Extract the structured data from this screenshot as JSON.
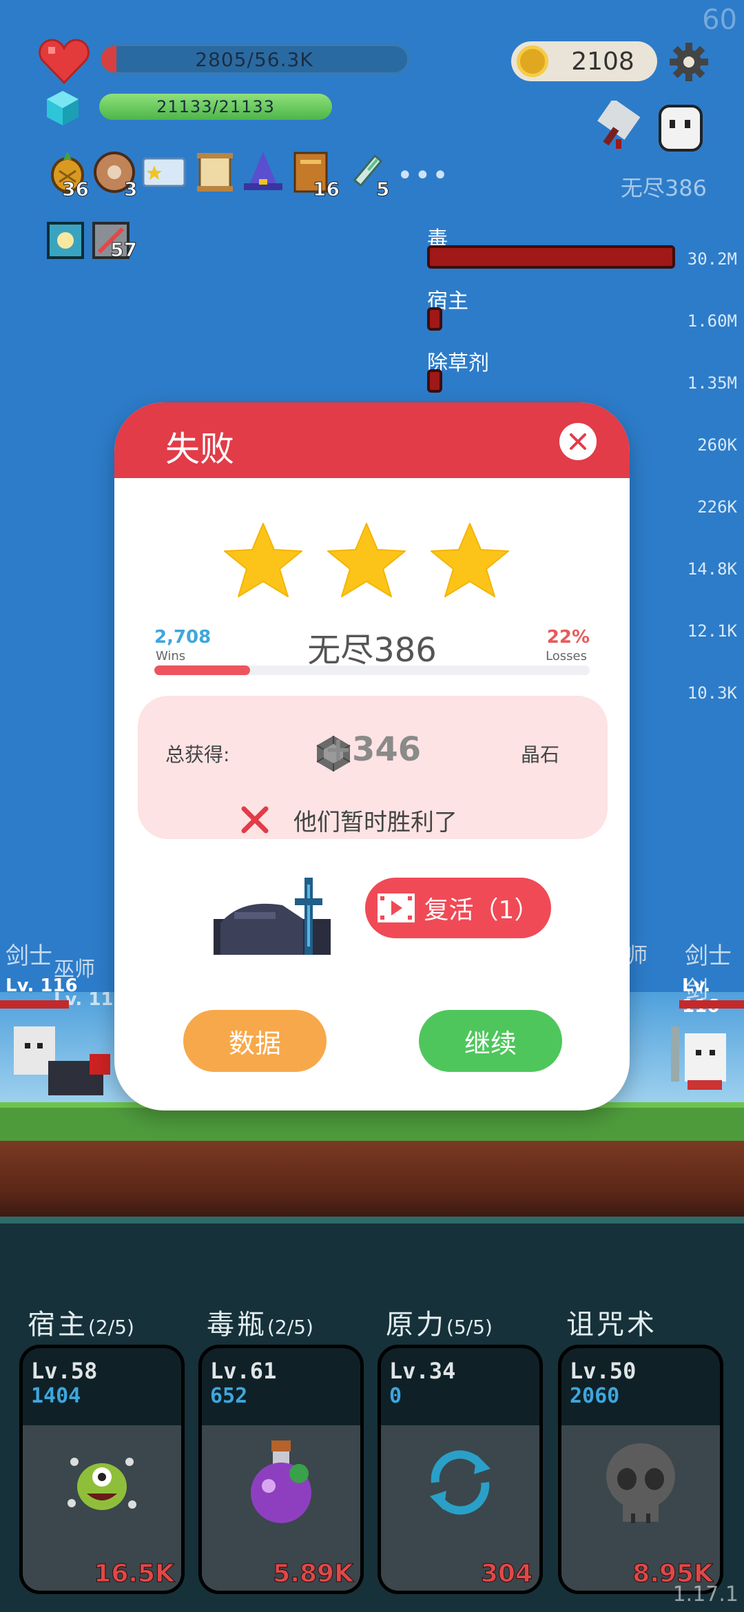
{
  "hud": {
    "fps": "60",
    "version": "1.17.1",
    "hp_text": "2805/56.3K",
    "hp_fill_pct": 5,
    "mp_text": "21133/21133",
    "mp_fill_pct": 100,
    "coins": "2108",
    "stage_label": "无尽386"
  },
  "items": [
    {
      "icon": "pineapple-icon",
      "count": "36"
    },
    {
      "icon": "shield-icon",
      "count": "3"
    },
    {
      "icon": "star-card-icon",
      "count": ""
    },
    {
      "icon": "scroll-icon",
      "count": ""
    },
    {
      "icon": "wizard-hat-icon",
      "count": ""
    },
    {
      "icon": "book-icon",
      "count": "16"
    },
    {
      "icon": "syringe-icon",
      "count": "5"
    }
  ],
  "skills": [
    {
      "icon": "light-skill-icon",
      "count": ""
    },
    {
      "icon": "blade-skill-icon",
      "count": "57"
    }
  ],
  "damage": [
    {
      "name": "毒",
      "value": "30.2M",
      "fill_pct": 100
    },
    {
      "name": "宿主",
      "value": "1.60M",
      "fill_pct": 5.3
    },
    {
      "name": "除草剂",
      "value": "1.35M",
      "fill_pct": 4.5
    },
    {
      "name": "",
      "value": "260K"
    },
    {
      "name": "",
      "value": "226K"
    },
    {
      "name": "",
      "value": "14.8K"
    },
    {
      "name": "",
      "value": "12.1K"
    },
    {
      "name": "",
      "value": "10.3K"
    }
  ],
  "scene": {
    "left_label": "剑士",
    "left_label2": "巫师",
    "left_lv": "Lv. 116",
    "left_lv2": "Lv. 116",
    "right_label": "剑士剑",
    "right_lv": "Lv. 116",
    "mid_label": "师",
    "mid_lv": "6"
  },
  "modal": {
    "title": "失败",
    "stars": 3,
    "wins_num": "2,708",
    "wins_label": "Wins",
    "stage_name": "无尽386",
    "losses_num": "22%",
    "losses_label": "Losses",
    "progress_pct": 22,
    "reward_label": "总获得:",
    "reward_value": "+346",
    "reward_unit": "晶石",
    "fail_msg": "他们暂时胜利了",
    "revive_label": "复活（1）",
    "data_button": "数据",
    "continue_button": "继续"
  },
  "cards": [
    {
      "title": "宿主",
      "count": "(2/5)",
      "lv": "Lv.58",
      "num": "1404",
      "cost": "16.5K",
      "icon": "monster-icon"
    },
    {
      "title": "毒瓶",
      "count": "(2/5)",
      "lv": "Lv.61",
      "num": "652",
      "cost": "5.89K",
      "icon": "potion-icon"
    },
    {
      "title": "原力",
      "count": "(5/5)",
      "lv": "Lv.34",
      "num": "0",
      "cost": "304",
      "icon": "cycle-icon"
    },
    {
      "title": "诅咒术",
      "count": "",
      "lv": "Lv.50",
      "num": "2060",
      "cost": "8.95K",
      "icon": "skull-icon"
    }
  ]
}
